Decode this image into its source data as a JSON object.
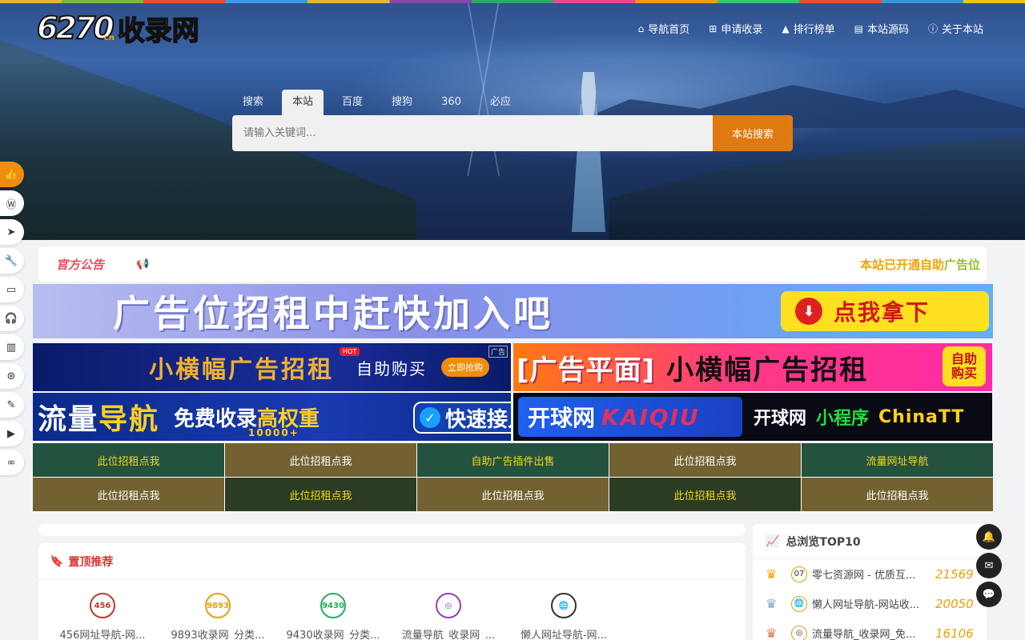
{
  "logo": {
    "number": "6270",
    "suffix": "cn",
    "text": "收录网"
  },
  "topnav": [
    {
      "icon": "home-icon",
      "glyph": "⌂",
      "label": "导航首页"
    },
    {
      "icon": "plus-square-icon",
      "glyph": "⊞",
      "label": "申请收录"
    },
    {
      "icon": "area-chart-icon",
      "glyph": "▲",
      "label": "排行榜单"
    },
    {
      "icon": "book-icon",
      "glyph": "▤",
      "label": "本站源码"
    },
    {
      "icon": "info-circle-icon",
      "glyph": "ⓘ",
      "label": "关于本站"
    }
  ],
  "search": {
    "tabs": [
      "搜索",
      "本站",
      "百度",
      "搜狗",
      "360",
      "必应"
    ],
    "active_tab": "本站",
    "placeholder": "请输入关键词...",
    "button": "本站搜索"
  },
  "side_bar": [
    {
      "icon": "thumbs-up-icon",
      "glyph": "👍"
    },
    {
      "icon": "wordpress-icon",
      "glyph": "Ⓦ"
    },
    {
      "icon": "paper-plane-icon",
      "glyph": "➤"
    },
    {
      "icon": "wrench-icon",
      "glyph": "🔧"
    },
    {
      "icon": "hdd-icon",
      "glyph": "▭"
    },
    {
      "icon": "headphones-icon",
      "glyph": "🎧"
    },
    {
      "icon": "book-icon",
      "glyph": "▥"
    },
    {
      "icon": "gamepad-icon",
      "glyph": "⊛"
    },
    {
      "icon": "paint-brush-icon",
      "glyph": "✎"
    },
    {
      "icon": "video-camera-icon",
      "glyph": "▶"
    },
    {
      "icon": "link-icon",
      "glyph": "∞"
    }
  ],
  "notice": {
    "title": "官方公告",
    "marquee_a": "本站已开通自助",
    "marquee_b": "广告位"
  },
  "banner_big": {
    "text": "广告位招租中赶快加入吧",
    "button": "点我拿下"
  },
  "ads": {
    "ad1": {
      "title": "小横幅广告招租",
      "hot": "HOT",
      "sub": "自助购买",
      "button": "立即抢购",
      "tag": "广告"
    },
    "ad2": {
      "title": "[广告平面]",
      "sub": "小横幅广告招租",
      "cart_a": "自助",
      "cart_b": "购买"
    },
    "ad3": {
      "title_a": "流量",
      "title_b": "导航",
      "sub_a": "免费收录",
      "sub_b": "高权重",
      "count": "10000+",
      "fast": "快速接入"
    },
    "ad4": {
      "brand_a": "开球网",
      "brand_b": "KAIQIU",
      "t1": "开球网",
      "t2": "小程序",
      "t3": "ChinaTT"
    }
  },
  "grid": [
    {
      "label": "此位招租点我",
      "bg": "dg",
      "color": "y"
    },
    {
      "label": "此位招租点我",
      "bg": "ol",
      "color": "w"
    },
    {
      "label": "自助广告插件出售",
      "bg": "dg",
      "color": "y"
    },
    {
      "label": "此位招租点我",
      "bg": "ol",
      "color": "w"
    },
    {
      "label": "流量网址导航",
      "bg": "dg",
      "color": "y"
    },
    {
      "label": "此位招租点我",
      "bg": "ol",
      "color": "w"
    },
    {
      "label": "此位招租点我",
      "bg": "dk",
      "color": "y"
    },
    {
      "label": "此位招租点我",
      "bg": "ol",
      "color": "w"
    },
    {
      "label": "此位招租点我",
      "bg": "dk",
      "color": "y"
    },
    {
      "label": "此位招租点我",
      "bg": "ol",
      "color": "w"
    }
  ],
  "pinned": {
    "title": "置顶推荐",
    "items": [
      {
        "icon": "site-456-icon",
        "label": "456网址导航-网...",
        "badge": "456",
        "color": "#c0392b"
      },
      {
        "icon": "site-9893-icon",
        "label": "9893收录网_分类...",
        "badge": "9893",
        "color": "#e8a010"
      },
      {
        "icon": "site-9430-icon",
        "label": "9430收录网_分类...",
        "badge": "9430",
        "color": "#27ae60"
      },
      {
        "icon": "site-liuliang-icon",
        "label": "流量导航_收录网_...",
        "badge": "◎",
        "color": "#8e44ad"
      },
      {
        "icon": "site-lanren-icon",
        "label": "懒人网址导航-网...",
        "badge": "🌐",
        "color": "#333333"
      }
    ]
  },
  "top10": {
    "title": "总浏览TOP10",
    "rows": [
      {
        "crown": "gold",
        "fav": "07",
        "name": "零七资源网 - 优质互...",
        "count": "21569"
      },
      {
        "crown": "silver",
        "fav": "🌐",
        "name": "懒人网址导航-网站收...",
        "count": "20050"
      },
      {
        "crown": "bronze",
        "fav": "◎",
        "name": "流量导航_收录网_免...",
        "count": "16106"
      }
    ]
  },
  "float_buttons": [
    {
      "icon": "bell-icon",
      "glyph": "🔔"
    },
    {
      "icon": "envelope-icon",
      "glyph": "✉"
    },
    {
      "icon": "wechat-icon",
      "glyph": "💬"
    }
  ]
}
